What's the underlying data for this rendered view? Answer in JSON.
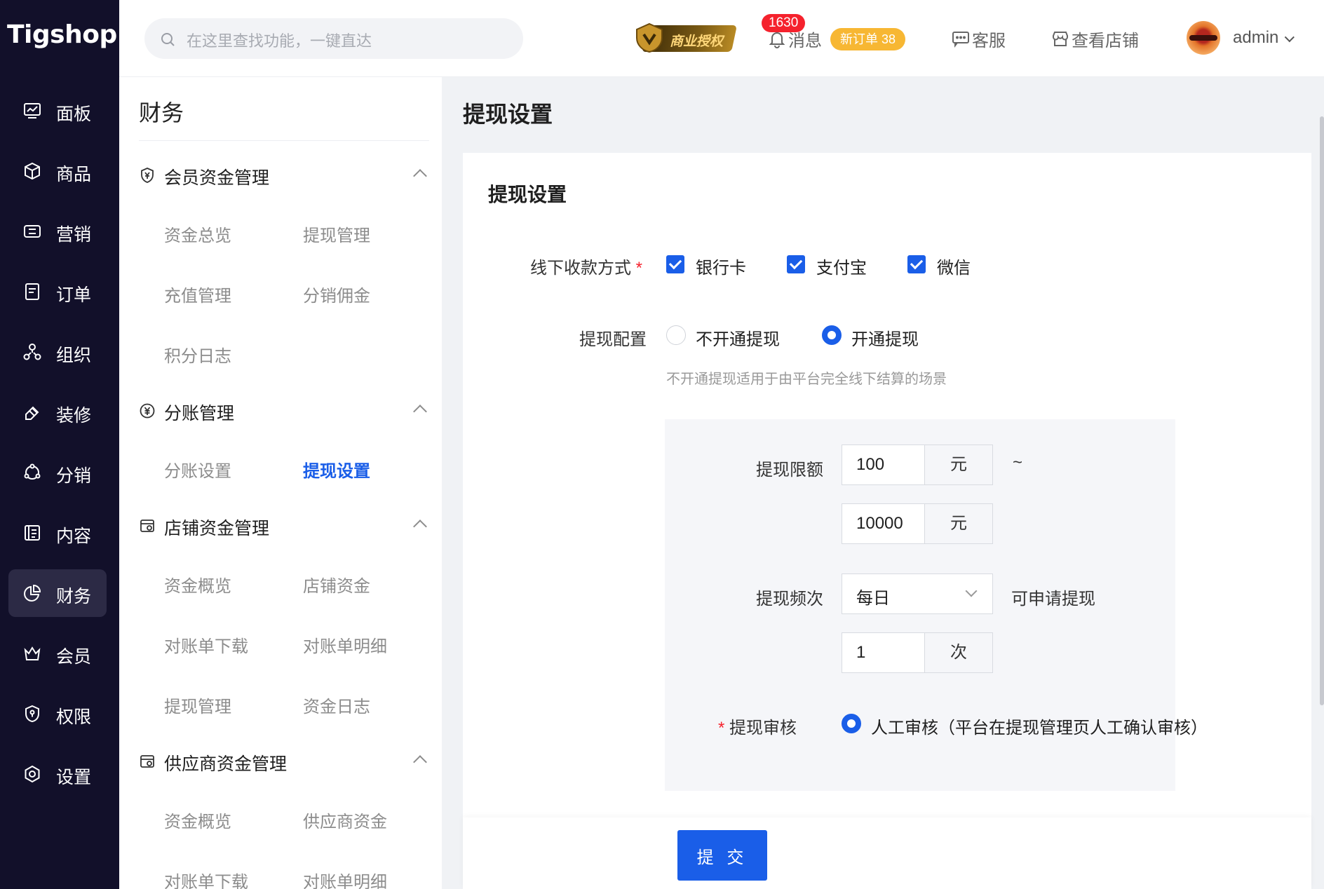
{
  "brand": {
    "logo_text": "Tigshop"
  },
  "nav": {
    "items": [
      {
        "label": "面板",
        "icon": "dashboard-icon"
      },
      {
        "label": "商品",
        "icon": "product-box-icon"
      },
      {
        "label": "营销",
        "icon": "marketing-icon"
      },
      {
        "label": "订单",
        "icon": "order-icon"
      },
      {
        "label": "组织",
        "icon": "organization-icon"
      },
      {
        "label": "装修",
        "icon": "decoration-icon"
      },
      {
        "label": "分销",
        "icon": "distribution-icon"
      },
      {
        "label": "内容",
        "icon": "content-icon"
      },
      {
        "label": "财务",
        "icon": "finance-icon",
        "active": true
      },
      {
        "label": "会员",
        "icon": "member-crown-icon"
      },
      {
        "label": "权限",
        "icon": "permission-shield-icon"
      },
      {
        "label": "设置",
        "icon": "settings-icon"
      }
    ]
  },
  "header": {
    "search_placeholder": "在这里查找功能，一键直达",
    "license_label": "商业授权",
    "message_label": "消息",
    "message_count": "1630",
    "new_order_label": "新订单 38",
    "service_label": "客服",
    "view_store_label": "查看店铺",
    "username": "admin"
  },
  "submenu": {
    "title": "财务",
    "groups": [
      {
        "label": "会员资金管理",
        "items": [
          "资金总览",
          "提现管理",
          "充值管理",
          "分销佣金",
          "积分日志"
        ]
      },
      {
        "label": "分账管理",
        "items": [
          "分账设置",
          "提现设置"
        ]
      },
      {
        "label": "店铺资金管理",
        "items": [
          "资金概览",
          "店铺资金",
          "对账单下载",
          "对账单明细",
          "提现管理",
          "资金日志"
        ]
      },
      {
        "label": "供应商资金管理",
        "items": [
          "资金概览",
          "供应商资金",
          "对账单下载",
          "对账单明细"
        ]
      }
    ]
  },
  "page": {
    "title": "提现设置",
    "card_title": "提现设置",
    "offline_methods": {
      "label": "线下收款方式",
      "required_mark": "*",
      "options": [
        "银行卡",
        "支付宝",
        "微信"
      ]
    },
    "withdraw_config": {
      "label": "提现配置",
      "options": [
        "不开通提现",
        "开通提现"
      ],
      "selected": "开通提现",
      "hint": "不开通提现适用于由平台完全线下结算的场景"
    },
    "limit": {
      "label": "提现限额",
      "min": "100",
      "max": "10000",
      "unit": "元",
      "separator": "~"
    },
    "frequency": {
      "label": "提现频次",
      "period": "每日",
      "suffix": "可申请提现",
      "times": "1",
      "times_unit": "次"
    },
    "review": {
      "label": "提现审核",
      "required_mark": "*",
      "option": "人工审核（平台在提现管理页人工确认审核）"
    },
    "submit_label": "提 交"
  },
  "colors": {
    "primary": "#1a5ee8",
    "rail": "#12102a",
    "badge_red": "#f5222d",
    "order_badge": "#f7b733"
  }
}
